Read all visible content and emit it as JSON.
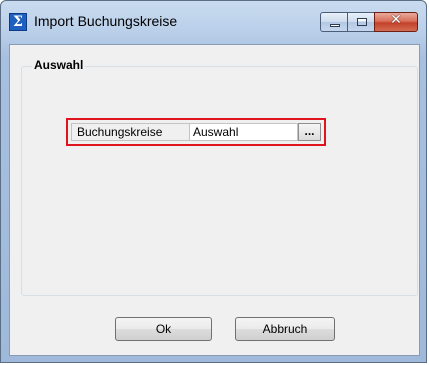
{
  "window": {
    "title": "Import Buchungskreise",
    "icon": "sigma-icon",
    "icon_glyph": "Σ",
    "controls": {
      "minimize": "minimize-icon",
      "maximize": "maximize-icon",
      "close": "close-icon",
      "close_glyph": "✕"
    }
  },
  "group": {
    "title": "Auswahl"
  },
  "field": {
    "label": "Buchungskreise",
    "value": "Auswahl",
    "browse_label": "..."
  },
  "buttons": {
    "ok": "Ok",
    "cancel": "Abbruch"
  },
  "colors": {
    "highlight": "#e0141e",
    "titlebar": "#b9cfe9",
    "close_button": "#c4412a"
  }
}
